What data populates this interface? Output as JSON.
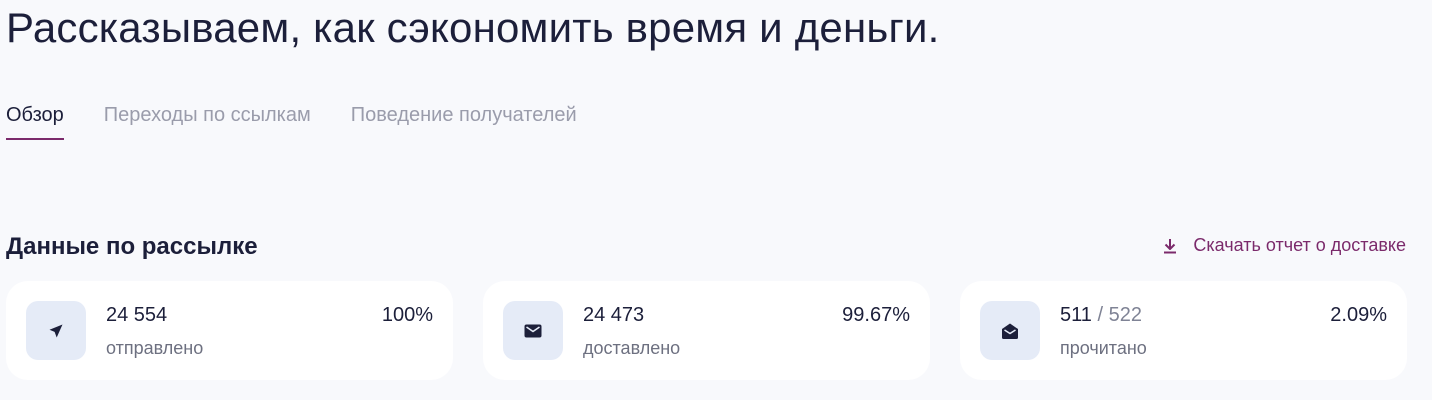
{
  "header": {
    "title": "Рассказываем, как сэкономить время и деньги."
  },
  "tabs": [
    {
      "label": "Обзор",
      "active": true
    },
    {
      "label": "Переходы по ссылкам",
      "active": false
    },
    {
      "label": "Поведение получателей",
      "active": false
    }
  ],
  "section": {
    "title": "Данные по рассылке",
    "download_label": "Скачать отчет о доставке",
    "download_icon": "download-icon"
  },
  "stats": [
    {
      "icon": "send-icon",
      "value": "24 554",
      "label": "отправлено",
      "percent": "100%"
    },
    {
      "icon": "envelope-icon",
      "value": "24 473",
      "label": "доставлено",
      "percent": "99.67%"
    },
    {
      "icon": "envelope-open-icon",
      "value": "511",
      "value_secondary": "/ 522",
      "label": "прочитано",
      "percent": "2.09%"
    }
  ],
  "colors": {
    "accent": "#7b2a6b",
    "text": "#1c1f3a",
    "muted": "#9a9cab",
    "background": "#f8f9fc",
    "card": "#ffffff",
    "icon_bg": "#e5ebf7"
  }
}
